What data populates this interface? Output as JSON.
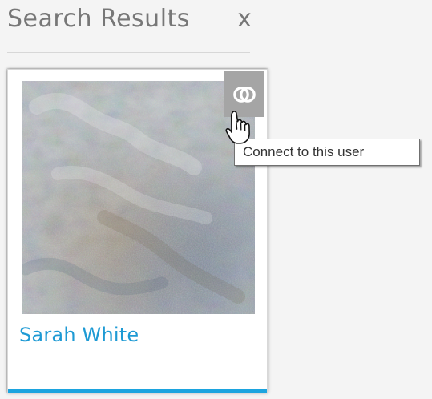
{
  "search_results": {
    "title": "Search Results",
    "close_label": "x",
    "result": {
      "name": "Sarah White",
      "connect_tooltip": "Connect to this user",
      "image_icon": "profile-photo-icon",
      "connect_icon": "link-rings-icon"
    }
  },
  "colors": {
    "accent": "#1ca4df",
    "name_link": "#1e9ad4",
    "connect_button": "#a5a5a5",
    "header_text": "#777777"
  }
}
